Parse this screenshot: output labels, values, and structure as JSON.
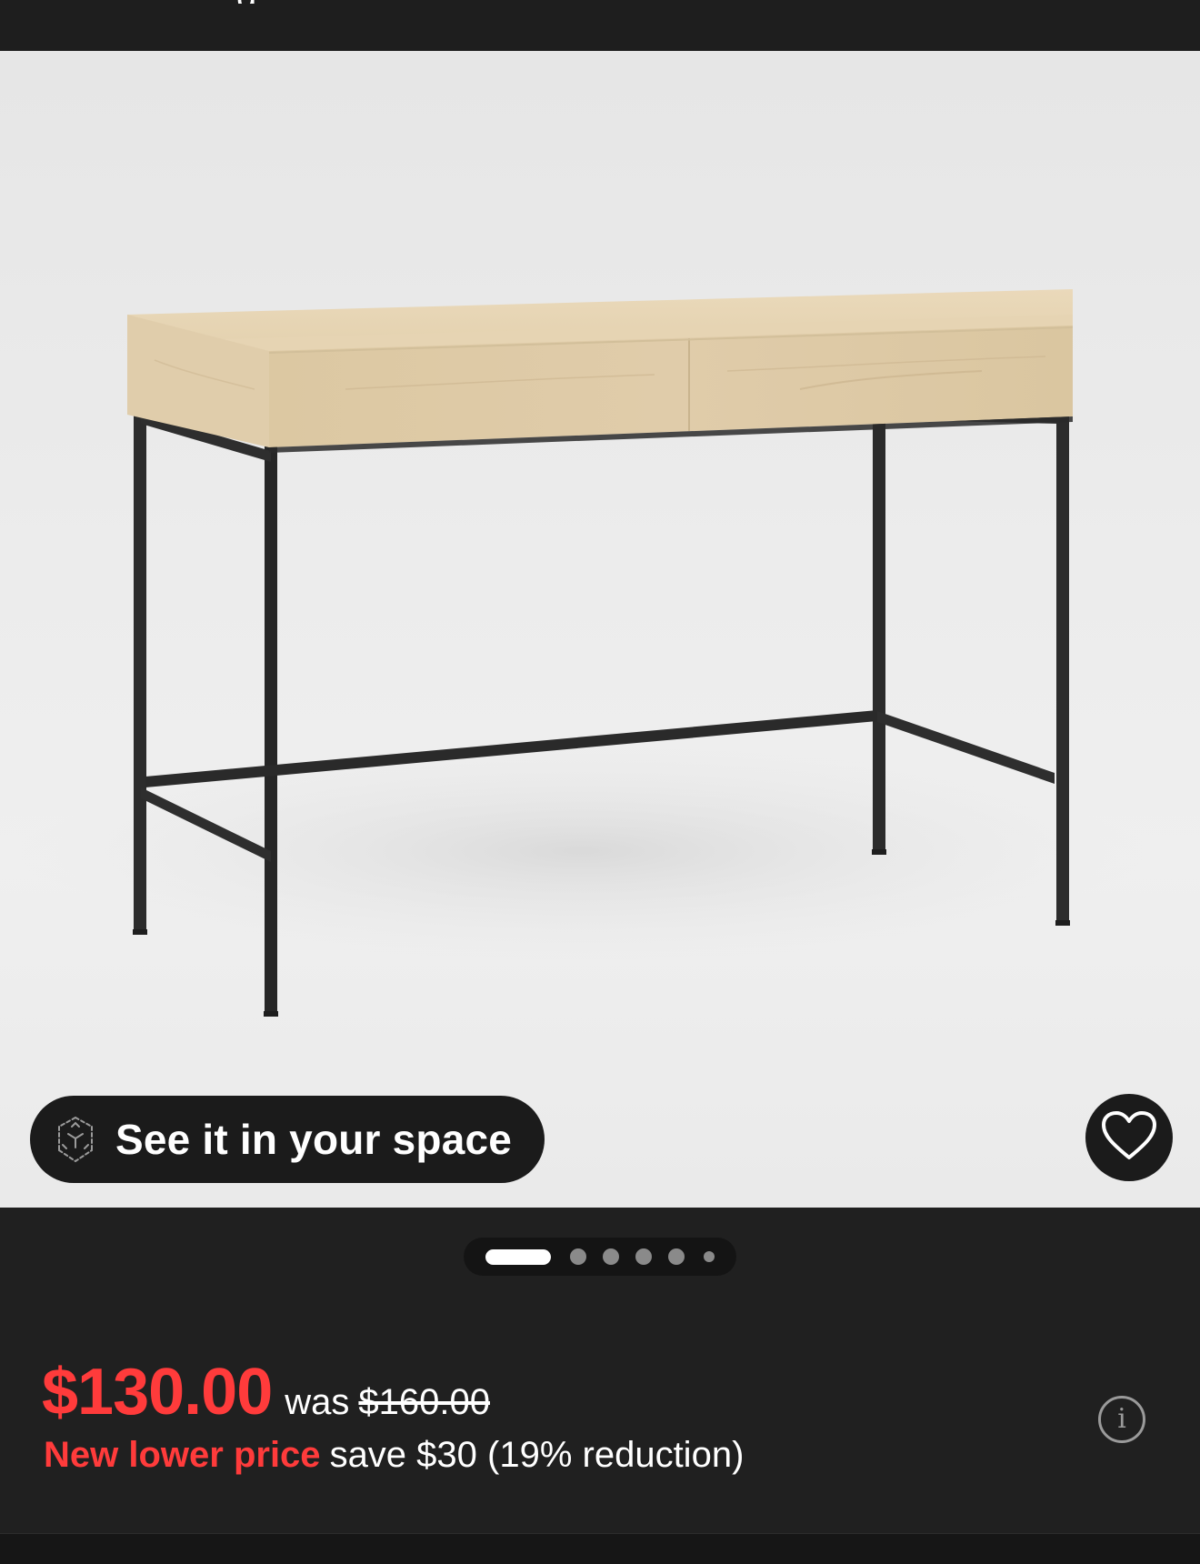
{
  "top_bar": {
    "partial_title": "g"
  },
  "product": {
    "image_alt": "wooden desk with black metal frame",
    "ar_label": "See it in your space",
    "ar_icon": "ar-cube-icon",
    "favorite_icon": "heart-icon"
  },
  "gallery": {
    "total_images": 6,
    "active_index": 0
  },
  "pricing": {
    "current_price": "$130.00",
    "was_label": "was",
    "was_price": "$160.00",
    "promo_label": "New lower price",
    "savings_text": "save $30 (19% reduction)",
    "info_icon": "info-icon",
    "info_glyph": "i"
  },
  "colors": {
    "price_red": "#ff3b3b",
    "background": "#202020",
    "button_dark": "#1b1b1b",
    "wood": "#e2cfa9",
    "metal": "#2a2a2a"
  }
}
